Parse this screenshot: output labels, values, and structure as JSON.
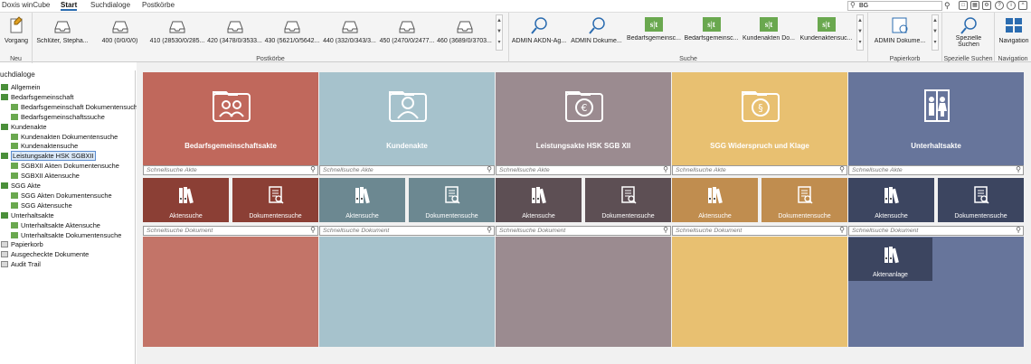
{
  "menu": {
    "app": "Doxis winCube",
    "tabs": [
      "Start",
      "Suchdialoge",
      "Postkörbe"
    ],
    "search_value": "BG"
  },
  "ribbon": {
    "neu": {
      "label": "Neu",
      "button": "Vorgang"
    },
    "postkoerbe": {
      "label": "Postkörbe",
      "items": [
        "Schlüter, Stepha...",
        "400 (0/0/0/0)",
        "410 (28530/0/285...",
        "420 (3478/0/3533...",
        "430 (5621/0/5642...",
        "440 (332/0/343/3...",
        "450 (2470/0/2477...",
        "460 (3689/0/3703..."
      ]
    },
    "suche": {
      "label": "Suche",
      "items": [
        "ADMIN AKDN-Ag...",
        "ADMIN Dokume...",
        "Bedarfsgemeinsc...",
        "Bedarfsgemeinsc...",
        "Kundenakten Do...",
        "Kundenaktensuc..."
      ]
    },
    "papierkorb": {
      "label": "Papierkorb",
      "button": "ADMIN Dokume..."
    },
    "spezielle": {
      "label": "Spezielle Suchen",
      "button_line1": "Spezielle",
      "button_line2": "Suchen"
    },
    "navigation": {
      "label": "Navigation",
      "button": "Navigation"
    }
  },
  "tree": {
    "title": "uchdialoge",
    "nodes": [
      {
        "label": "Allgemein",
        "level": 0
      },
      {
        "label": "Bedarfsgemeinschaft",
        "level": 0
      },
      {
        "label": "Bedarfsgemeinschaft Dokumentensuche",
        "level": 1
      },
      {
        "label": "Bedarfsgemeinschaftssuche",
        "level": 1
      },
      {
        "label": "Kundenakte",
        "level": 0
      },
      {
        "label": "Kundenakten Dokumentensuche",
        "level": 1
      },
      {
        "label": "Kundenaktensuche",
        "level": 1
      },
      {
        "label": "Leistungsakte HSK SGBXII",
        "level": 0
      },
      {
        "label": "SGBXII Akten Dokumentensuche",
        "level": 1
      },
      {
        "label": "SGBXII Aktensuche",
        "level": 1
      },
      {
        "label": "SGG Akte",
        "level": 0
      },
      {
        "label": "SGG Akten Dokumentensuche",
        "level": 1
      },
      {
        "label": "SGG Aktensuche",
        "level": 1
      },
      {
        "label": "Unterhaltsakte",
        "level": 0
      },
      {
        "label": "Unterhaltsakte Aktensuche",
        "level": 1
      },
      {
        "label": "Unterhaltsakte Dokumentensuche",
        "level": 1
      },
      {
        "label": "Papierkorb",
        "level": 0
      },
      {
        "label": "Ausgecheckte Dokumente",
        "level": 0
      },
      {
        "label": "Audit Trail",
        "level": 0
      }
    ]
  },
  "tiles": [
    {
      "title": "Bedarfsgemeinschaftsakte",
      "icon": "family-folder-icon",
      "color": "#c0685c",
      "dark": "#8b3f35",
      "light": "#c37468"
    },
    {
      "title": "Kundenakte",
      "icon": "person-folder-icon",
      "color": "#a6c2cc",
      "dark": "#6c8891",
      "light": "#a6c2cc"
    },
    {
      "title": "Leistungsakte HSK SGB XII",
      "icon": "euro-folder-icon",
      "color": "#9b8b90",
      "dark": "#5d4f54",
      "light": "#9b8b90"
    },
    {
      "title": "SGG Widerspruch und Klage",
      "icon": "paragraph-folder-icon",
      "color": "#e8c071",
      "dark": "#c08d4f",
      "light": "#e8c071"
    },
    {
      "title": "Unterhaltsakte",
      "icon": "family-door-icon",
      "color": "#67759b",
      "dark": "#3c4560",
      "light": "#67759b"
    }
  ],
  "labels": {
    "schnellsuche_akte": "Schnellsuche Akte",
    "schnellsuche_dokument": "Schnellsuche Dokument",
    "aktensuche": "Aktensuche",
    "dokumentensuche": "Dokumentensuche",
    "aktenanlage": "Aktenanlage"
  }
}
